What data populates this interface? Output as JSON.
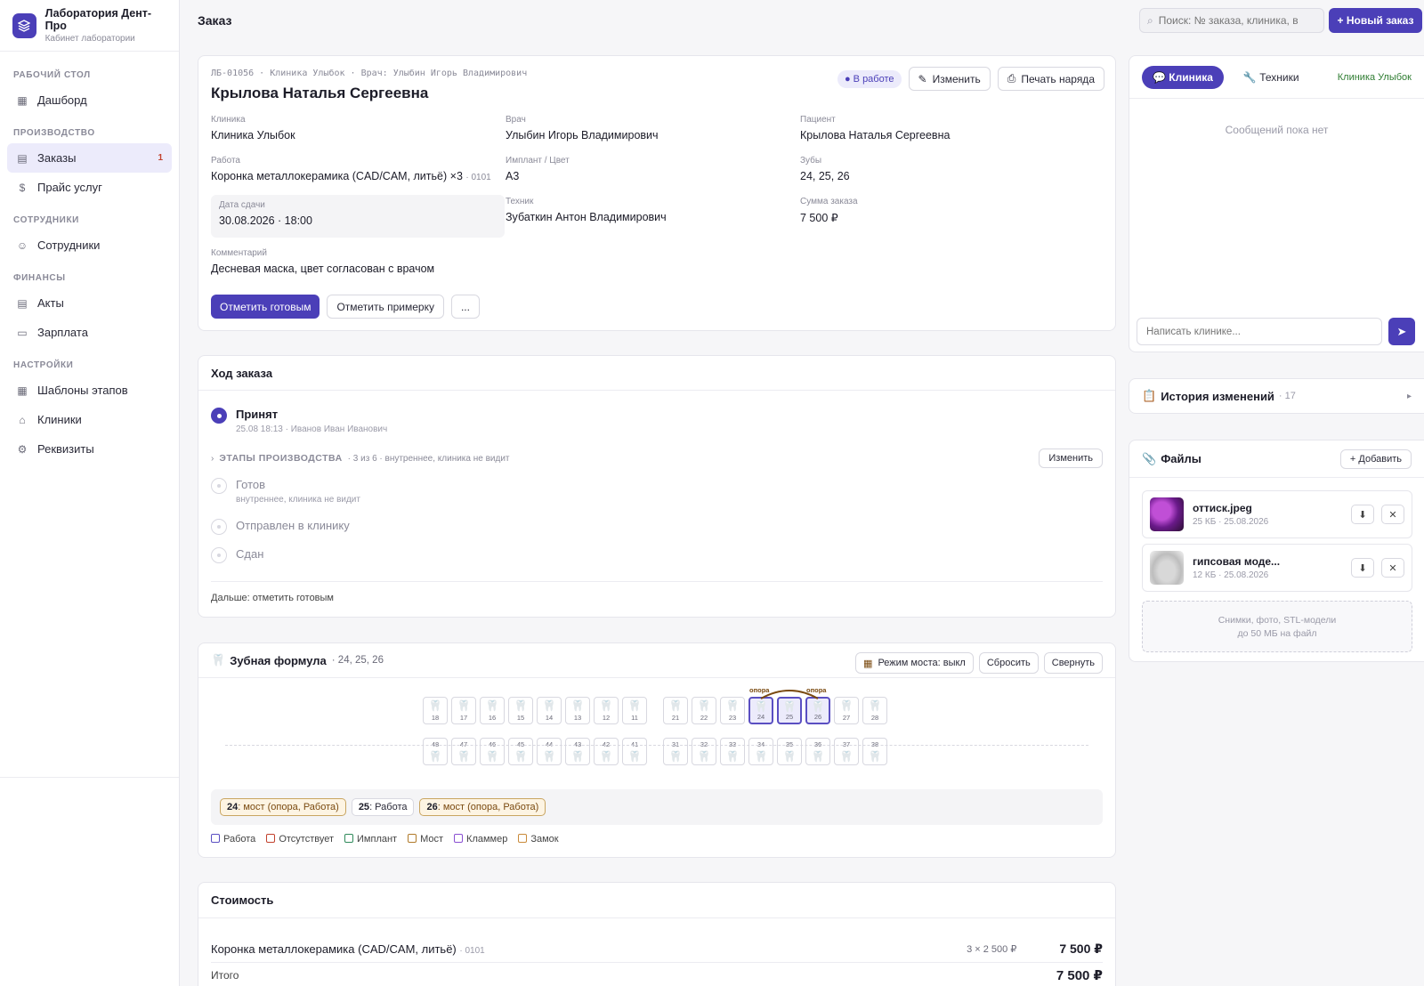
{
  "brand": {
    "name": "Лаборатория Дент-Про",
    "subtitle": "Кабинет лаборатории"
  },
  "nav": {
    "sec_desktop": "РАБОЧИЙ СТОЛ",
    "dashboard": "Дашборд",
    "sec_production": "ПРОИЗВОДСТВО",
    "orders": "Заказы",
    "orders_badge": "1",
    "pricelist": "Прайс услуг",
    "sec_staff": "СОТРУДНИКИ",
    "staff": "Сотрудники",
    "sec_finance": "ФИНАНСЫ",
    "acts": "Акты",
    "salary": "Зарплата",
    "sec_settings": "НАСТРОЙКИ",
    "stage_templates": "Шаблоны этапов",
    "clinics": "Клиники",
    "requisites": "Реквизиты"
  },
  "topbar": {
    "title": "Заказ",
    "search_placeholder": "Поиск: № заказа, клиника, в",
    "new_order": "Новый заказ"
  },
  "order": {
    "meta": "ЛБ-01056 · Клиника Улыбок · Врач: Улыбин Игорь Владимирович",
    "patient_title": "Крылова Наталья Сергеевна",
    "status": "В работе",
    "edit": "Изменить",
    "print": "Печать наряда",
    "clinic_label": "Клиника",
    "clinic": "Клиника Улыбок",
    "doctor_label": "Врач",
    "doctor": "Улыбин Игорь Владимирович",
    "patient_label": "Пациент",
    "patient": "Крылова Наталья Сергеевна",
    "work_label": "Работа",
    "work": "Коронка металлокерамика (CAD/CAM, литьё)",
    "work_qty": "×3",
    "work_code": "· 0101",
    "implant_label": "Имплант / Цвет",
    "implant": "A3",
    "teeth_label": "Зубы",
    "teeth": "24, 25, 26",
    "due_label": "Дата сдачи",
    "due": "30.08.2026 · 18:00",
    "tech_label": "Техник",
    "tech": "Зубаткин Антон Владимирович",
    "sum_label": "Сумма заказа",
    "sum": "7 500 ₽",
    "comment_label": "Комментарий",
    "comment": "Десневая маска, цвет согласован с врачом",
    "mark_ready": "Отметить готовым",
    "mark_fitting": "Отметить примерку",
    "more": "..."
  },
  "progress": {
    "title": "Ход заказа",
    "accepted": "Принят",
    "accepted_sub": "25.08 18:13 · Иванов Иван Иванович",
    "stages_label": "ЭТАПЫ ПРОИЗВОДСТВА",
    "stages_info": "· 3 из 6 · внутреннее, клиника не видит",
    "stages_edit": "Изменить",
    "ready": "Готов",
    "ready_sub": "внутреннее, клиника не видит",
    "sent": "Отправлен в клинику",
    "handed": "Сдан",
    "next": "Дальше: отметить готовым"
  },
  "formula": {
    "title": "Зубная формула",
    "teeth_sub": "· 24, 25, 26",
    "bridge_mode": "Режим моста: выкл",
    "reset": "Сбросить",
    "collapse": "Свернуть",
    "upper": [
      "18",
      "17",
      "16",
      "15",
      "14",
      "13",
      "12",
      "11",
      "21",
      "22",
      "23",
      "24",
      "25",
      "26",
      "27",
      "28"
    ],
    "lower": [
      "48",
      "47",
      "46",
      "45",
      "44",
      "43",
      "42",
      "41",
      "31",
      "32",
      "33",
      "34",
      "35",
      "36",
      "37",
      "38"
    ],
    "selected": [
      "24",
      "25",
      "26"
    ],
    "abutment_label": "опора",
    "tags": [
      {
        "tooth": "24",
        "text": ": мост (опора, Работа)"
      },
      {
        "tooth": "25",
        "text": ": Работа"
      },
      {
        "tooth": "26",
        "text": ": мост (опора, Работа)"
      }
    ],
    "legend": [
      {
        "label": "Работа",
        "color": "#5a4fc2"
      },
      {
        "label": "Отсутствует",
        "color": "#c2412d"
      },
      {
        "label": "Имплант",
        "color": "#2f8a5a"
      },
      {
        "label": "Мост",
        "color": "#b07a2a"
      },
      {
        "label": "Кламмер",
        "color": "#8a4fd2"
      },
      {
        "label": "Замок",
        "color": "#c98a3a"
      }
    ]
  },
  "cost": {
    "title": "Стоимость",
    "item": "Коронка металлокерамика (CAD/CAM, литьё)",
    "item_code": "· 0101",
    "qty": "3 × 2 500 ₽",
    "item_sum": "7 500 ₽",
    "total_label": "Итого",
    "total": "7 500 ₽"
  },
  "chat": {
    "tab_clinic": "Клиника",
    "tab_techs": "Техники",
    "clinic_name": "Клиника Улыбок",
    "empty": "Сообщений пока нет",
    "input_placeholder": "Написать клинике..."
  },
  "history": {
    "title": "История изменений",
    "count": "· 17"
  },
  "files": {
    "title": "Файлы",
    "add": "+ Добавить",
    "items": [
      {
        "name": "оттиск.jpeg",
        "meta": "25 КБ · 25.08.2026"
      },
      {
        "name": "гипсовая моде...",
        "meta": "12 КБ · 25.08.2026"
      }
    ],
    "drop_line1": "Снимки, фото, STL-модели",
    "drop_line2": "до 50 МБ на файл"
  },
  "colors": {
    "accent": "#4b3fb8",
    "bridge": "#7a4a10"
  }
}
